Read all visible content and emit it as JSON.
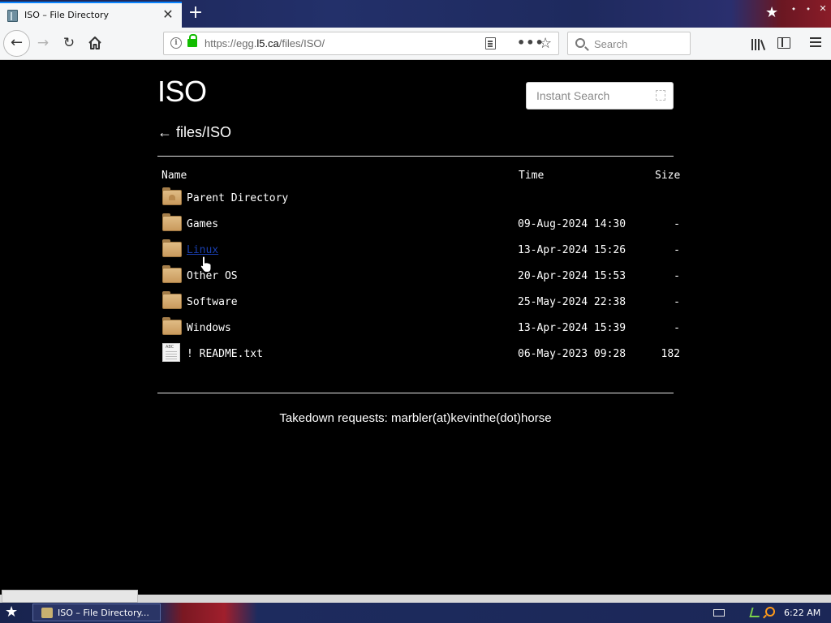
{
  "browser": {
    "tab": {
      "title": "ISO – File Directory"
    },
    "url": {
      "prefix": "https://egg.",
      "host": "l5.ca",
      "path": "/files/ISO/"
    },
    "search_placeholder": "Search"
  },
  "page": {
    "title": "ISO",
    "instant_search_placeholder": "Instant Search",
    "breadcrumb": {
      "arrow": "←",
      "path": "files/ISO"
    },
    "columns": {
      "name": "Name",
      "time": "Time",
      "size": "Size"
    },
    "rows": [
      {
        "name": "Parent Directory",
        "time": "",
        "size": "",
        "type": "parent"
      },
      {
        "name": "Games",
        "time": "09-Aug-2024 14:30",
        "size": "-",
        "type": "folder"
      },
      {
        "name": "Linux",
        "time": "13-Apr-2024 15:26",
        "size": "-",
        "type": "folder",
        "hovered": true
      },
      {
        "name": "Other OS",
        "time": "20-Apr-2024 15:53",
        "size": "-",
        "type": "folder"
      },
      {
        "name": "Software",
        "time": "25-May-2024 22:38",
        "size": "-",
        "type": "folder"
      },
      {
        "name": "Windows",
        "time": "13-Apr-2024 15:39",
        "size": "-",
        "type": "folder"
      },
      {
        "name": "! README.txt",
        "time": "06-May-2023 09:28",
        "size": "182",
        "type": "file"
      }
    ],
    "footer": "Takedown requests: marbler(at)kevinthe(dot)horse"
  },
  "taskbar": {
    "task_label": "ISO – File Directory...",
    "clock": "6:22 AM"
  },
  "colors": {
    "link_visited": "#1a3fb0",
    "page_bg": "#000000",
    "tab_accent": "#0a84ff"
  }
}
